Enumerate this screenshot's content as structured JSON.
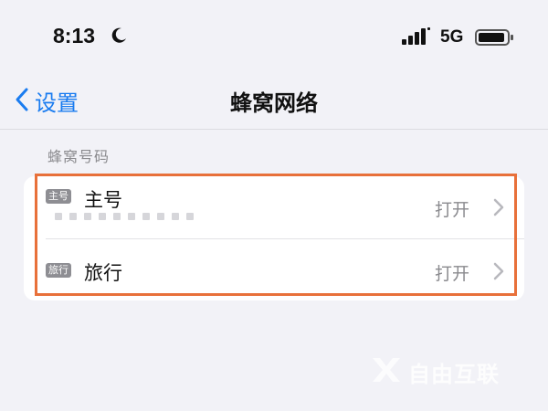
{
  "status_bar": {
    "time": "8:13",
    "moon_icon": "moon-icon",
    "signal_icon": "cellular-signal-icon",
    "network": "5G",
    "battery_icon": "battery-icon"
  },
  "nav": {
    "back_label": "设置",
    "title": "蜂窝网络"
  },
  "section": {
    "header": "蜂窝号码"
  },
  "lines": [
    {
      "tag": "主号",
      "label": "主号",
      "value": "打开"
    },
    {
      "tag": "旅行",
      "label": "旅行",
      "value": "打开"
    }
  ],
  "highlight_color": "#e8703a",
  "accent_color": "#1a7cf0",
  "watermark": {
    "text": "自由互联"
  }
}
